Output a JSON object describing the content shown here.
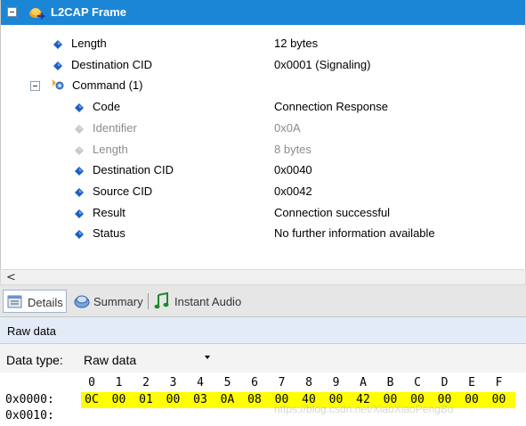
{
  "frame": {
    "title": "L2CAP Frame",
    "header_color": "#1c86d6"
  },
  "fields": [
    {
      "label": "Length",
      "value": "12 bytes",
      "dim": false
    },
    {
      "label": "Destination CID",
      "value": "0x0001 (Signaling)",
      "dim": false
    }
  ],
  "command": {
    "label": "Command (1)",
    "fields": [
      {
        "label": "Code",
        "value": "Connection Response",
        "dim": false
      },
      {
        "label": "Identifier",
        "value": "0x0A",
        "dim": true
      },
      {
        "label": "Length",
        "value": "8 bytes",
        "dim": true
      },
      {
        "label": "Destination CID",
        "value": "0x0040",
        "dim": false
      },
      {
        "label": "Source CID",
        "value": "0x0042",
        "dim": false
      },
      {
        "label": "Result",
        "value": "Connection successful",
        "dim": false
      },
      {
        "label": "Status",
        "value": "No further information available",
        "dim": false
      }
    ]
  },
  "scroll": {
    "left_arrow": "<"
  },
  "tabs": [
    {
      "label": "Details",
      "icon": "details-icon",
      "active": true
    },
    {
      "label": "Summary",
      "icon": "summary-icon",
      "active": false
    },
    {
      "label": "Instant Audio",
      "icon": "audio-note-icon",
      "active": false
    }
  ],
  "raw": {
    "header": "Raw data",
    "data_type_label": "Data type:",
    "data_type_value": "Raw data",
    "columns": [
      "0",
      "1",
      "2",
      "3",
      "4",
      "5",
      "6",
      "7",
      "8",
      "9",
      "A",
      "B",
      "C",
      "D",
      "E",
      "F"
    ],
    "lines": [
      {
        "offset": "0x0000:",
        "bytes": [
          "0C",
          "00",
          "01",
          "00",
          "03",
          "0A",
          "08",
          "00",
          "40",
          "00",
          "42",
          "00",
          "00",
          "00",
          "00",
          "00"
        ],
        "highlight_color": "#ffff00"
      },
      {
        "offset": "0x0010:",
        "bytes": []
      }
    ]
  },
  "watermark": "https://blog.csdn.net/XiaoXiaoPengBo"
}
